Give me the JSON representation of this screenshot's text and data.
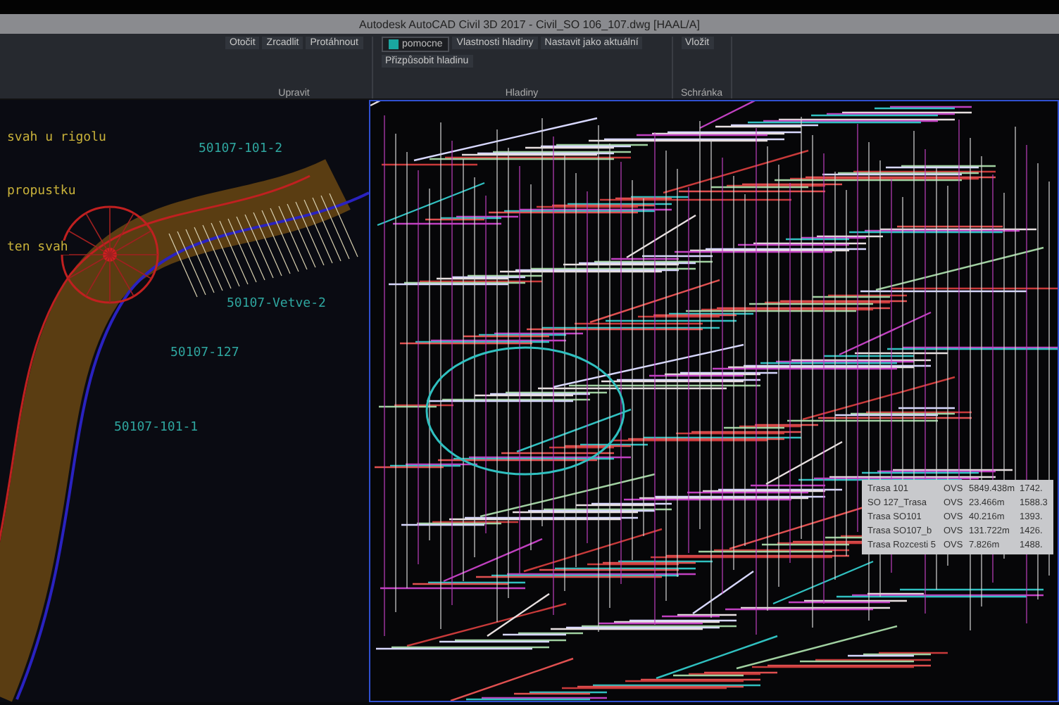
{
  "window": {
    "title": "Autodesk AutoCAD Civil 3D 2017 - Civil_SO 106_107.dwg [HAAL/A]"
  },
  "ribbon": {
    "groups": [
      {
        "label": "Upravit",
        "buttons": [
          "Otočit",
          "Zrcadlit",
          "Protáhnout"
        ]
      },
      {
        "label": "Hladiny",
        "layer": "pomocne",
        "buttons": [
          "Vlastnosti hladiny",
          "Nastavit jako aktuální",
          "Přizpůsobit hladinu"
        ]
      },
      {
        "label": "Schránka",
        "buttons": [
          "Vložit"
        ]
      }
    ]
  },
  "drawing": {
    "labels": [
      {
        "text": "svah u rigolu",
        "color": "#c9b23a"
      },
      {
        "text": "50107-101-2",
        "color": "#2fa7a0"
      },
      {
        "text": "propustku",
        "color": "#c9b23a"
      },
      {
        "text": "ten svah",
        "color": "#c9b23a"
      },
      {
        "text": "50107-Vetve-2",
        "color": "#2fa7a0"
      },
      {
        "text": "50107-127",
        "color": "#2fa7a0"
      },
      {
        "text": "50107-101-1",
        "color": "#2fa7a0"
      }
    ]
  },
  "tooltip": {
    "rows": [
      {
        "name": "Trasa 101",
        "code": "OVS",
        "length": "5849.438m",
        "value": "1742."
      },
      {
        "name": "SO 127_Trasa",
        "code": "OVS",
        "length": "23.466m",
        "value": "1588.3"
      },
      {
        "name": "Trasa SO101",
        "code": "OVS",
        "length": "40.216m",
        "value": "1393."
      },
      {
        "name": "Trasa SO107_b",
        "code": "OVS",
        "length": "131.722m",
        "value": "1426."
      },
      {
        "name": "Trasa Rozcesti 5",
        "code": "OVS",
        "length": "7.826m",
        "value": "1488."
      }
    ]
  }
}
